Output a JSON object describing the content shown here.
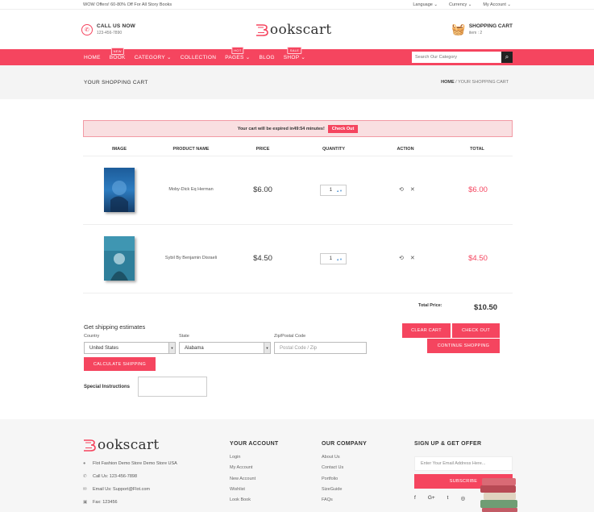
{
  "topbar": {
    "promo": "WOW Offers! 60-80% Off For All Story Books",
    "language": "Language ⌄",
    "currency": "Currency ⌄",
    "account": "My Account ⌄"
  },
  "header": {
    "call_label": "CALL US NOW",
    "phone": "123-456-7890",
    "logo_letter": "B",
    "logo_rest": "ookscart",
    "cart_label": "SHOPPING CART",
    "cart_count": "item : 2"
  },
  "nav": {
    "items": [
      {
        "label": "HOME",
        "tag": ""
      },
      {
        "label": "BOOK",
        "tag": "NEW"
      },
      {
        "label": "CATEGORY ⌄",
        "tag": ""
      },
      {
        "label": "COLLECTION",
        "tag": ""
      },
      {
        "label": "PAGES ⌄",
        "tag": "HOT"
      },
      {
        "label": "BLOG",
        "tag": ""
      },
      {
        "label": "SHOP ⌄",
        "tag": "SALE"
      }
    ],
    "search_placeholder": "Search Our Category"
  },
  "pagehead": {
    "title": "YOUR SHOPPING CART",
    "bc_home": "HOME",
    "bc_sep": " / ",
    "bc_current": "YOUR SHOPPING CART"
  },
  "timer": {
    "text": "Your cart will be expired in49:54 minutes!",
    "button": "Check Out"
  },
  "table": {
    "headers": [
      "IMAGE",
      "PRODUCT NAME",
      "PRICE",
      "QUANTITY",
      "ACTION",
      "TOTAL"
    ],
    "rows": [
      {
        "name": "Moby-Dick Eq Herman",
        "price": "$6.00",
        "qty": "1",
        "total": "$6.00"
      },
      {
        "name": "Sybil By Benjamin Disraeli",
        "price": "$4.50",
        "qty": "1",
        "total": "$4.50"
      }
    ]
  },
  "summary": {
    "label": "Total Price:",
    "value": "$10.50"
  },
  "shipping": {
    "title": "Get shipping estimates",
    "country_label": "Country",
    "country": "United States",
    "state_label": "State",
    "state": "Alabama",
    "zip_label": "Zip/Postal Code",
    "zip_placeholder": "Postal Code / Zip",
    "calc_button": "CALCULATE SHIPPING"
  },
  "buttons": {
    "clear": "CLEAR CART",
    "checkout": "CHECK OUT",
    "continue": "CONTINUE SHOPPING"
  },
  "special": {
    "label": "Special Instructions"
  },
  "footer": {
    "contact": [
      "Flot Fashion Demo Store Demo Store USA",
      "Call Us: 123-456-7898",
      "Email Us: Support@Flot.com",
      "Fax: 123456"
    ],
    "account_title": "YOUR ACCOUNT",
    "account_links": [
      "Login",
      "My Account",
      "New Account",
      "Wishlist",
      "Look Book"
    ],
    "company_title": "OUR COMPANY",
    "company_links": [
      "About Us",
      "Contact Us",
      "Portfolio",
      "SizeGuide",
      "FAQs"
    ],
    "signup_title": "SIGN UP & GET OFFER",
    "email_placeholder": "Enter Your Email Address Here...",
    "subscribe": "SUBSCRIBE",
    "social": [
      "f",
      "G+",
      "t",
      "◎"
    ]
  },
  "colors": {
    "accent": "#f5455f"
  }
}
